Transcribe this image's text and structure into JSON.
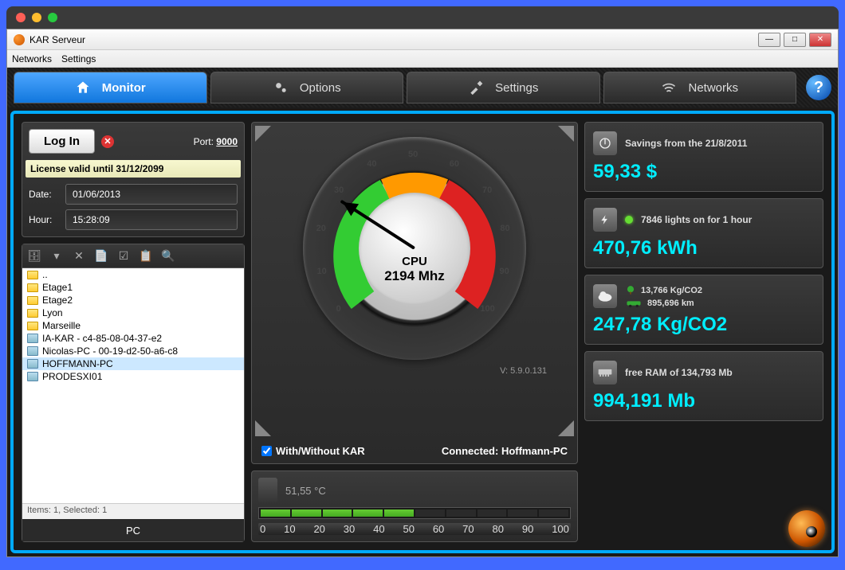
{
  "window": {
    "title": "KAR Serveur"
  },
  "menubar": {
    "networks": "Networks",
    "settings": "Settings"
  },
  "tabs": {
    "monitor": "Monitor",
    "options": "Options",
    "settings": "Settings",
    "networks": "Networks"
  },
  "login": {
    "button": "Log In",
    "port_label": "Port:",
    "port_value": "9000",
    "license": "License valid until 31/12/2099",
    "date_label": "Date:",
    "date_value": "01/06/2013",
    "hour_label": "Hour:",
    "hour_value": "15:28:09"
  },
  "tree": {
    "items": [
      {
        "type": "folder",
        "label": ".."
      },
      {
        "type": "folder",
        "label": "Etage1"
      },
      {
        "type": "folder",
        "label": "Etage2"
      },
      {
        "type": "folder",
        "label": "Lyon"
      },
      {
        "type": "folder",
        "label": "Marseille"
      },
      {
        "type": "pc",
        "label": "IA-KAR - c4-85-08-04-37-e2"
      },
      {
        "type": "pc",
        "label": "Nicolas-PC - 00-19-d2-50-a6-c8"
      },
      {
        "type": "pc",
        "label": "HOFFMANN-PC",
        "selected": true
      },
      {
        "type": "pc",
        "label": "PRODESXI01"
      }
    ],
    "status": "Items: 1, Selected: 1",
    "footer": "PC"
  },
  "gauge": {
    "label": "CPU",
    "value": "2194 Mhz",
    "version": "V: 5.9.0.131",
    "checkbox": "With/Without KAR",
    "connected": "Connected: Hoffmann-PC",
    "ticks": [
      "0",
      "10",
      "20",
      "30",
      "40",
      "50",
      "60",
      "70",
      "80",
      "90",
      "100"
    ],
    "needle_pct": 28
  },
  "temp": {
    "value": "51,55 °C",
    "scale": [
      "0",
      "10",
      "20",
      "30",
      "40",
      "50",
      "60",
      "70",
      "80",
      "90",
      "100"
    ],
    "filled": 5
  },
  "stats": {
    "savings": {
      "head": "Savings from the 21/8/2011",
      "value": "59,33 $"
    },
    "energy": {
      "head": "7846 lights on for 1 hour",
      "value": "470,76 kWh"
    },
    "co2": {
      "head1": "13,766 Kg/CO2",
      "head2": "895,696 km",
      "value": "247,78 Kg/CO2"
    },
    "ram": {
      "head": "free RAM of 134,793 Mb",
      "value": "994,191 Mb"
    }
  }
}
